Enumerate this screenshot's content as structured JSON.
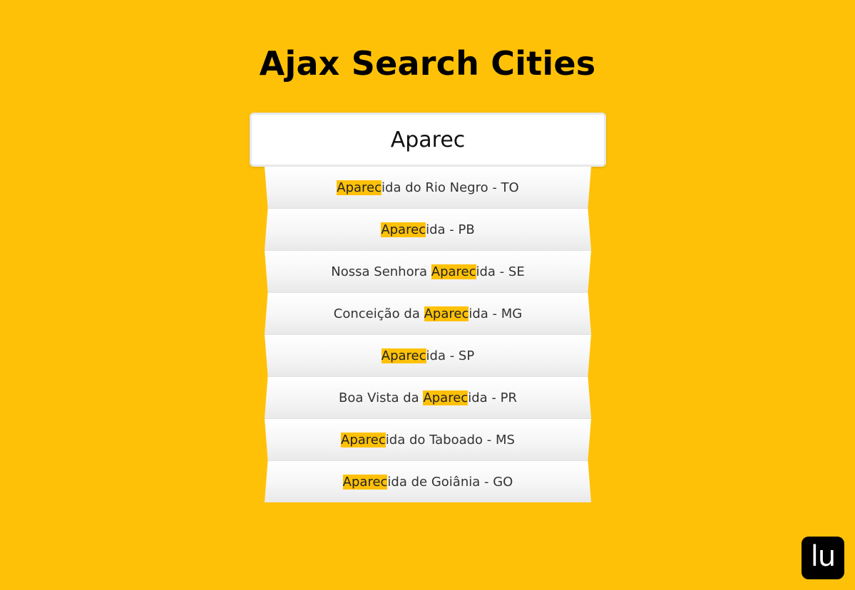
{
  "title": "Ajax Search Cities",
  "search": {
    "value": "Aparec"
  },
  "results": [
    {
      "before": "",
      "match": "Aparec",
      "after": "ida do Rio Negro - TO"
    },
    {
      "before": "",
      "match": "Aparec",
      "after": "ida - PB"
    },
    {
      "before": "Nossa Senhora ",
      "match": "Aparec",
      "after": "ida - SE"
    },
    {
      "before": "Conceição da ",
      "match": "Aparec",
      "after": "ida - MG"
    },
    {
      "before": "",
      "match": "Aparec",
      "after": "ida - SP"
    },
    {
      "before": "Boa Vista da ",
      "match": "Aparec",
      "after": "ida - PR"
    },
    {
      "before": "",
      "match": "Aparec",
      "after": "ida do Taboado - MS"
    },
    {
      "before": "",
      "match": "Aparec",
      "after": "ida de Goiânia - GO"
    }
  ],
  "logo": {
    "text": "lu"
  },
  "colors": {
    "background": "#FFC107",
    "highlight": "#FFC107"
  }
}
